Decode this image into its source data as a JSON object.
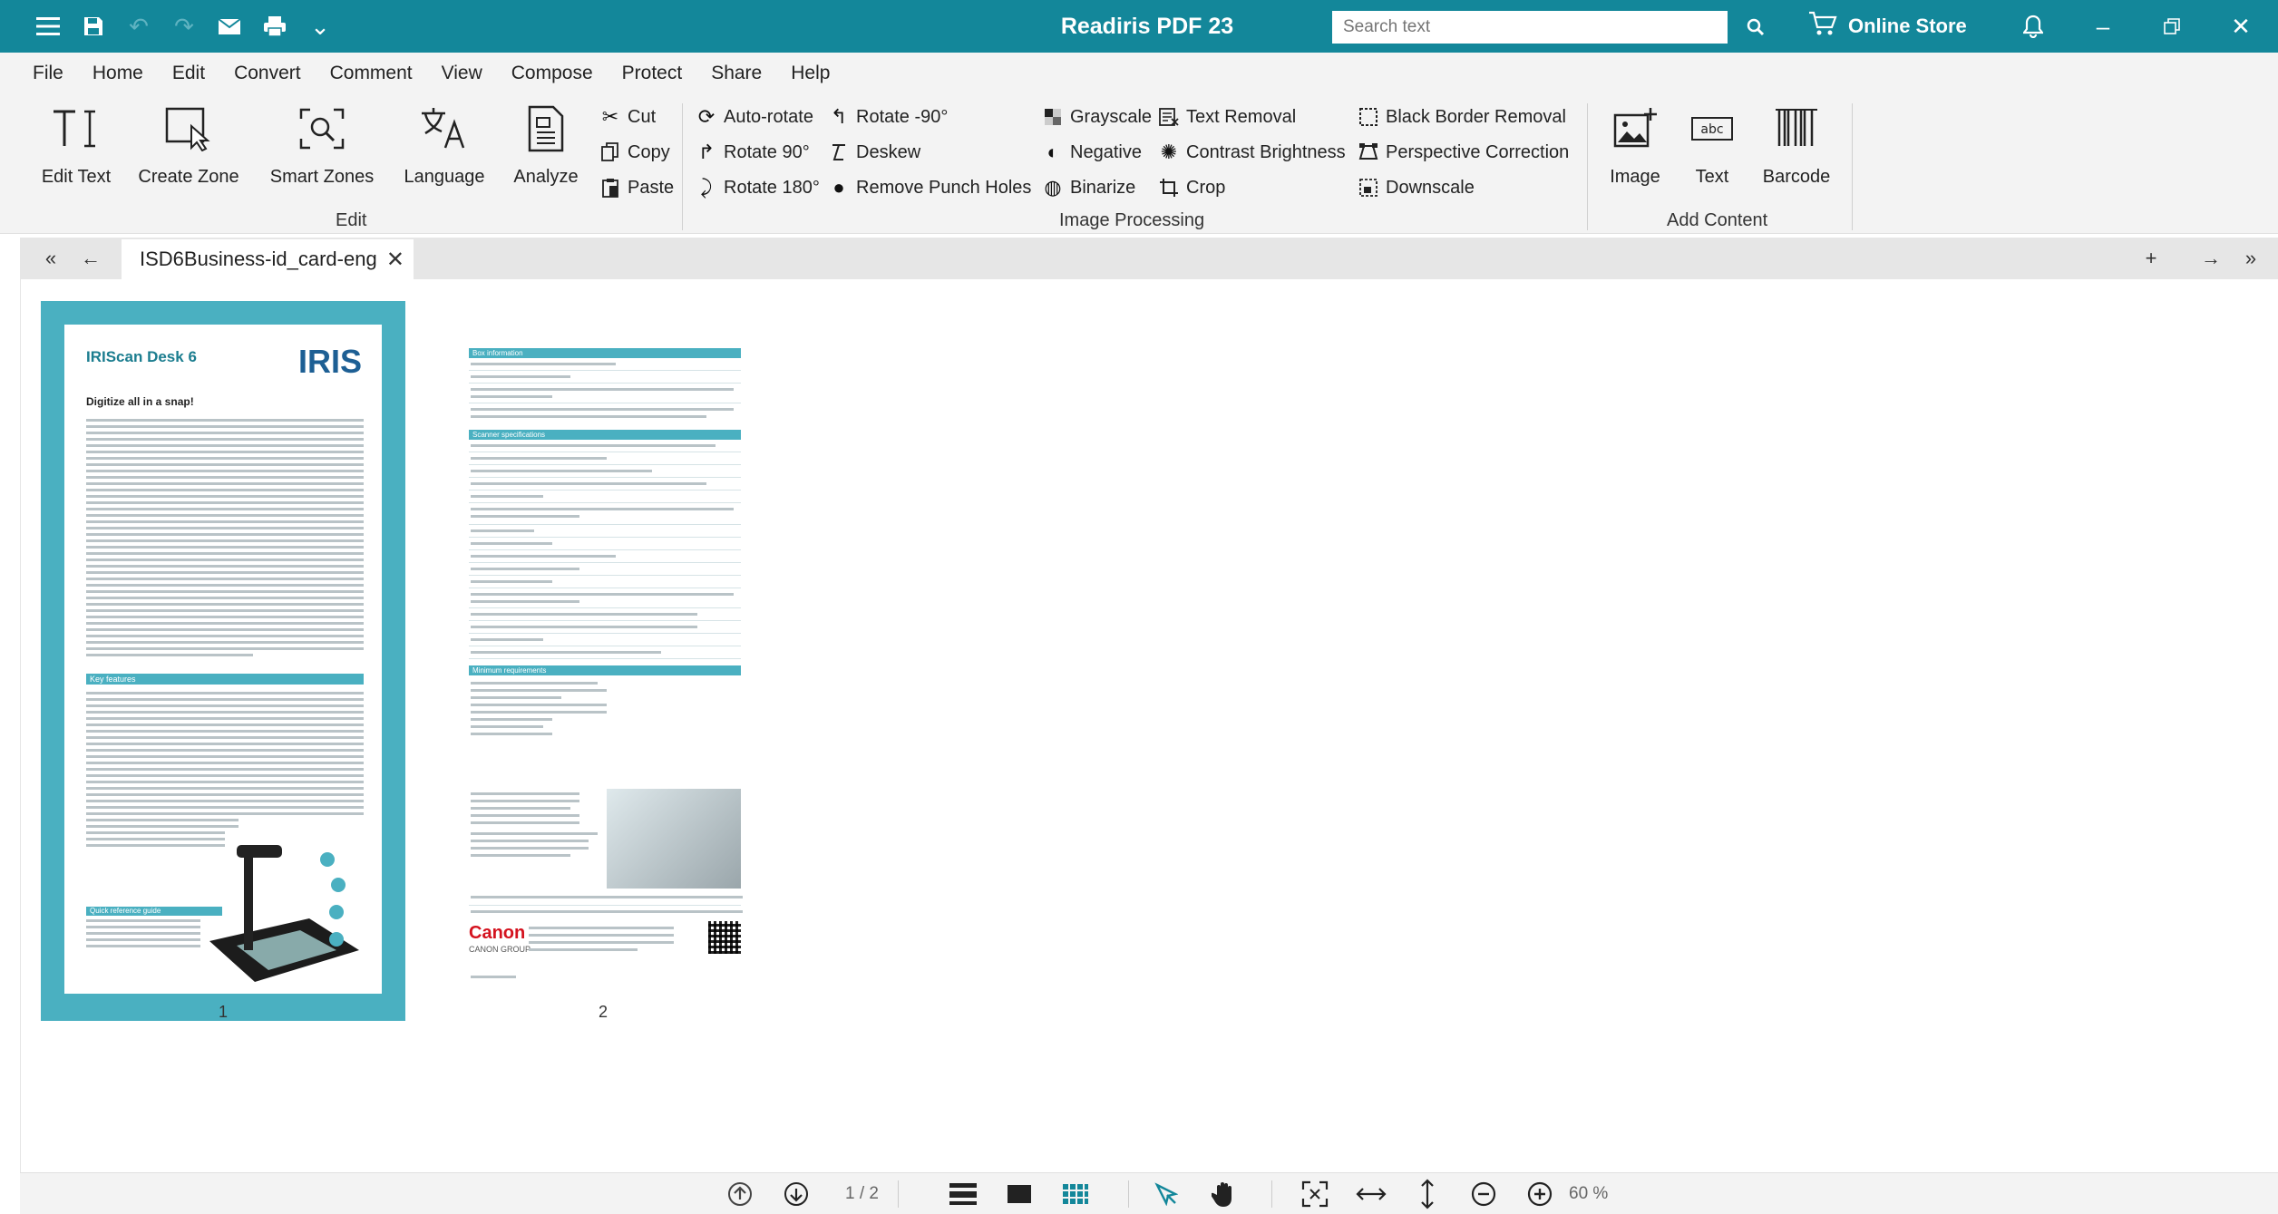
{
  "app": {
    "title": "Readiris PDF 23",
    "accent": "#13879a"
  },
  "search": {
    "placeholder": "Search text"
  },
  "store": {
    "label": "Online Store"
  },
  "menu": [
    "File",
    "Home",
    "Edit",
    "Convert",
    "Comment",
    "View",
    "Compose",
    "Protect",
    "Share",
    "Help"
  ],
  "active_menu": "Edit",
  "ribbon": {
    "edit_text": "Edit Text",
    "create_zone": "Create Zone",
    "smart_zones": "Smart Zones",
    "language": "Language",
    "analyze": "Analyze",
    "cut": "Cut",
    "copy": "Copy",
    "paste": "Paste",
    "edit_group": "Edit",
    "auto_rotate": "Auto-rotate",
    "rotate_90": "Rotate 90°",
    "rotate_180": "Rotate 180°",
    "rotate_minus_90": "Rotate -90°",
    "deskew": "Deskew",
    "remove_punch_holes": "Remove Punch Holes",
    "grayscale": "Grayscale",
    "negative": "Negative",
    "binarize": "Binarize",
    "text_removal": "Text Removal",
    "contrast_brightness": "Contrast Brightness",
    "crop": "Crop",
    "black_border_removal": "Black Border Removal",
    "perspective_correction": "Perspective Correction",
    "downscale": "Downscale",
    "image_processing_group": "Image Processing",
    "image": "Image",
    "text": "Text",
    "barcode": "Barcode",
    "add_content_group": "Add Content",
    "text_icon_label": "abc"
  },
  "tab": {
    "label": "ISD6Business-id_card-eng"
  },
  "pages": {
    "p1_num": "1",
    "p2_num": "2",
    "p1_logo_left": "IRIScan Desk 6",
    "p1_logo_right": "IRIS",
    "p1_heading": "Digitize all in a snap!",
    "p1_key_features": "Key features",
    "p1_quick_ref": "Quick reference guide",
    "p2_box_info": "Box information",
    "p2_scanner_specs": "Scanner specifications",
    "p2_min_req": "Minimum requirements",
    "p2_canon": "Canon",
    "p2_canon_group": "CANON GROUP"
  },
  "status": {
    "page_indicator": "1 / 2",
    "zoom_value": "60",
    "zoom_unit": "%"
  }
}
